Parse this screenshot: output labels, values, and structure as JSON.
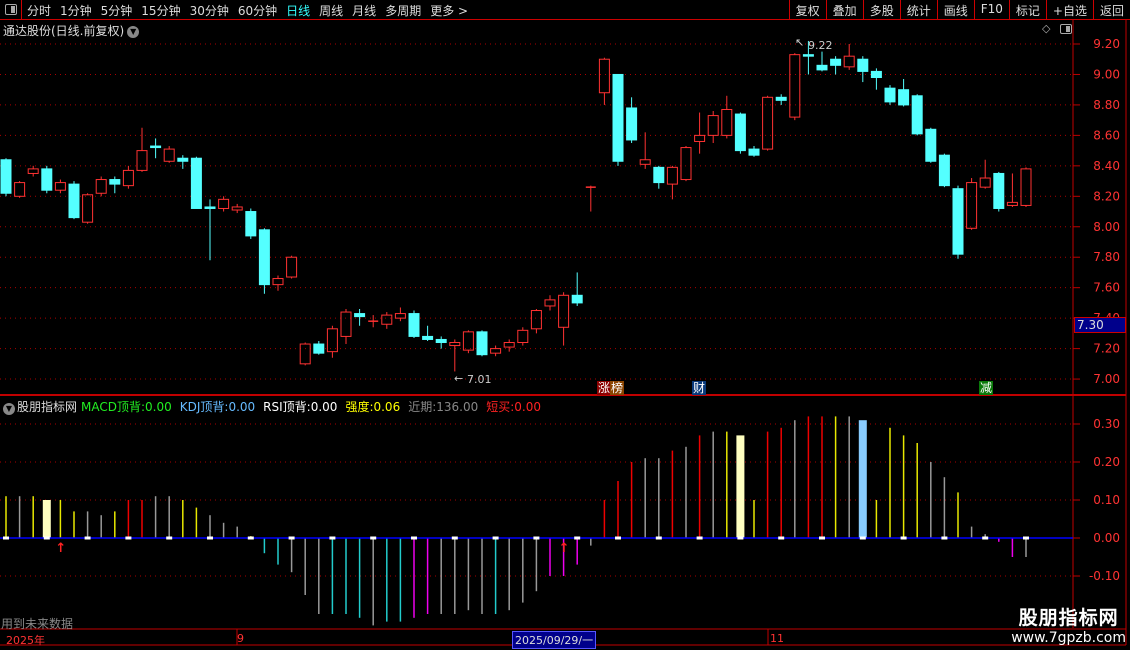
{
  "toolbar": {
    "periods": [
      "分时",
      "1分钟",
      "5分钟",
      "15分钟",
      "30分钟",
      "60分钟",
      "日线",
      "周线",
      "月线",
      "多周期",
      "更多 >"
    ],
    "active": "日线",
    "buttons": [
      "复权",
      "叠加",
      "多股",
      "统计",
      "画线",
      "F10",
      "标记",
      "+自选",
      "返回"
    ]
  },
  "stock_title": "通达股份(日线.前复权)",
  "price_axis": {
    "ticks": [
      "9.20",
      "9.00",
      "8.80",
      "8.60",
      "8.40",
      "8.20",
      "8.00",
      "7.80",
      "7.60",
      "7.40",
      "7.20",
      "7.00"
    ],
    "current": "7.30"
  },
  "annotations": {
    "high": "9.22",
    "low": "7.01"
  },
  "markers": [
    {
      "text": "涨",
      "color": "#8b0000"
    },
    {
      "text": "榜",
      "color": "#8b4500"
    },
    {
      "text": "财",
      "color": "#0a3a7a"
    },
    {
      "text": "减",
      "color": "#0a7a0a"
    }
  ],
  "indicator": {
    "name": "股朋指标网",
    "items": [
      {
        "label": "MACD顶背:",
        "value": "0.00",
        "color": "#22ee22"
      },
      {
        "label": "KDJ顶背:",
        "value": "0.00",
        "color": "#66bbff"
      },
      {
        "label": "RSI顶背:",
        "value": "0.00",
        "color": "#ffffff"
      },
      {
        "label": "强度:",
        "value": "0.06",
        "color": "#ffff00"
      },
      {
        "label": "近期:",
        "value": "136.00",
        "color": "#888888"
      },
      {
        "label": "短买:",
        "value": "0.00",
        "color": "#ff2222"
      }
    ],
    "axis": [
      "0.30",
      "0.20",
      "0.10",
      "0.00",
      "-0.10"
    ],
    "footer": "用到未来数据"
  },
  "date_axis": {
    "labels": [
      "2025年",
      "9",
      "11"
    ],
    "current": "2025/09/29/一"
  },
  "watermark": {
    "title": "股朋指标网",
    "url": "www.7gpzb.com"
  },
  "colors": {
    "up": "#ff3232",
    "down": "#54ffff",
    "grid": "#c00000",
    "zero": "#0000ff"
  },
  "chart_data": {
    "type": "candlestick",
    "ylim": [
      6.95,
      9.3
    ],
    "candles": [
      [
        8.44,
        8.22,
        8.45,
        8.2
      ],
      [
        8.2,
        8.29,
        8.3,
        8.19
      ],
      [
        8.35,
        8.38,
        8.4,
        8.33
      ],
      [
        8.38,
        8.24,
        8.4,
        8.22
      ],
      [
        8.24,
        8.29,
        8.31,
        8.22
      ],
      [
        8.28,
        8.06,
        8.3,
        8.05
      ],
      [
        8.03,
        8.21,
        8.22,
        8.02
      ],
      [
        8.22,
        8.31,
        8.33,
        8.2
      ],
      [
        8.31,
        8.28,
        8.33,
        8.22
      ],
      [
        8.27,
        8.37,
        8.4,
        8.25
      ],
      [
        8.37,
        8.5,
        8.65,
        8.36
      ],
      [
        8.53,
        8.52,
        8.58,
        8.45
      ],
      [
        8.43,
        8.51,
        8.53,
        8.42
      ],
      [
        8.45,
        8.43,
        8.47,
        8.38
      ],
      [
        8.45,
        8.12,
        8.46,
        8.12
      ],
      [
        8.13,
        8.12,
        8.18,
        7.78
      ],
      [
        8.12,
        8.18,
        8.2,
        8.1
      ],
      [
        8.11,
        8.13,
        8.15,
        8.09
      ],
      [
        8.1,
        7.94,
        8.12,
        7.92
      ],
      [
        7.98,
        7.62,
        7.99,
        7.56
      ],
      [
        7.62,
        7.66,
        7.68,
        7.58
      ],
      [
        7.67,
        7.8,
        7.81,
        7.66
      ],
      [
        7.1,
        7.23,
        7.24,
        7.09
      ],
      [
        7.23,
        7.17,
        7.25,
        7.16
      ],
      [
        7.18,
        7.33,
        7.35,
        7.14
      ],
      [
        7.28,
        7.44,
        7.46,
        7.23
      ],
      [
        7.43,
        7.41,
        7.46,
        7.35
      ],
      [
        7.38,
        7.38,
        7.42,
        7.34
      ],
      [
        7.36,
        7.42,
        7.44,
        7.33
      ],
      [
        7.4,
        7.43,
        7.47,
        7.38
      ],
      [
        7.43,
        7.28,
        7.45,
        7.27
      ],
      [
        7.28,
        7.26,
        7.35,
        7.25
      ],
      [
        7.26,
        7.24,
        7.28,
        7.2
      ],
      [
        7.22,
        7.24,
        7.26,
        7.05
      ],
      [
        7.19,
        7.31,
        7.32,
        7.17
      ],
      [
        7.31,
        7.16,
        7.32,
        7.15
      ],
      [
        7.17,
        7.2,
        7.22,
        7.15
      ],
      [
        7.21,
        7.24,
        7.26,
        7.18
      ],
      [
        7.24,
        7.32,
        7.34,
        7.22
      ],
      [
        7.33,
        7.45,
        7.46,
        7.3
      ],
      [
        7.48,
        7.52,
        7.55,
        7.45
      ],
      [
        7.34,
        7.55,
        7.57,
        7.22
      ],
      [
        7.55,
        7.5,
        7.7,
        7.48
      ],
      [
        8.26,
        8.26,
        8.27,
        8.1
      ],
      [
        8.88,
        9.1,
        9.11,
        8.8
      ],
      [
        9.0,
        8.43,
        9.0,
        8.4
      ],
      [
        8.78,
        8.57,
        8.85,
        8.55
      ],
      [
        8.41,
        8.44,
        8.62,
        8.38
      ],
      [
        8.39,
        8.29,
        8.4,
        8.25
      ],
      [
        8.28,
        8.39,
        8.4,
        8.18
      ],
      [
        8.31,
        8.52,
        8.53,
        8.3
      ],
      [
        8.56,
        8.6,
        8.75,
        8.48
      ],
      [
        8.6,
        8.73,
        8.76,
        8.55
      ],
      [
        8.6,
        8.77,
        8.86,
        8.58
      ],
      [
        8.74,
        8.5,
        8.75,
        8.48
      ],
      [
        8.51,
        8.47,
        8.53,
        8.46
      ],
      [
        8.51,
        8.85,
        8.86,
        8.5
      ],
      [
        8.85,
        8.83,
        8.87,
        8.8
      ],
      [
        8.72,
        9.13,
        9.14,
        8.7
      ],
      [
        9.13,
        9.12,
        9.22,
        9.0
      ],
      [
        9.06,
        9.03,
        9.15,
        9.02
      ],
      [
        9.1,
        9.06,
        9.12,
        9.0
      ],
      [
        9.05,
        9.12,
        9.2,
        9.03
      ],
      [
        9.1,
        9.02,
        9.12,
        8.95
      ],
      [
        9.02,
        8.98,
        9.04,
        8.9
      ],
      [
        8.91,
        8.82,
        8.93,
        8.8
      ],
      [
        8.9,
        8.8,
        8.97,
        8.79
      ],
      [
        8.86,
        8.61,
        8.87,
        8.6
      ],
      [
        8.64,
        8.43,
        8.65,
        8.42
      ],
      [
        8.47,
        8.27,
        8.48,
        8.26
      ],
      [
        8.25,
        7.82,
        8.27,
        7.79
      ],
      [
        7.99,
        8.29,
        8.32,
        7.98
      ],
      [
        8.26,
        8.32,
        8.44,
        8.25
      ],
      [
        8.35,
        8.12,
        8.36,
        8.1
      ],
      [
        8.14,
        8.16,
        8.35,
        8.13
      ],
      [
        8.14,
        8.38,
        8.39,
        8.13
      ]
    ],
    "histogram": {
      "ylim": [
        -0.15,
        0.33
      ],
      "values": [
        0.11,
        0.11,
        0.11,
        0.1,
        0.1,
        0.07,
        0.07,
        0.06,
        0.07,
        0.1,
        0.1,
        0.11,
        0.11,
        0.1,
        0.08,
        0.06,
        0.04,
        0.03,
        0.005,
        -0.04,
        -0.07,
        -0.09,
        -0.15,
        -0.2,
        -0.2,
        -0.2,
        -0.21,
        -0.23,
        -0.22,
        -0.22,
        -0.21,
        -0.2,
        -0.2,
        -0.2,
        -0.19,
        -0.2,
        -0.2,
        -0.19,
        -0.17,
        -0.14,
        -0.1,
        -0.1,
        -0.07,
        -0.02,
        0.1,
        0.15,
        0.2,
        0.21,
        0.21,
        0.23,
        0.24,
        0.27,
        0.28,
        0.28,
        0.27,
        0.1,
        0.28,
        0.29,
        0.31,
        0.32,
        0.32,
        0.32,
        0.32,
        0.31,
        0.1,
        0.29,
        0.27,
        0.25,
        0.2,
        0.16,
        0.12,
        0.03,
        0.01,
        -0.01,
        -0.05,
        -0.05
      ],
      "colors": "ygyWyyggyrrggyygggyccgggcccgccmmggggcgggmmmgrrrggrgrgyWyrrgrryglyyyyggyggmm"
    }
  }
}
